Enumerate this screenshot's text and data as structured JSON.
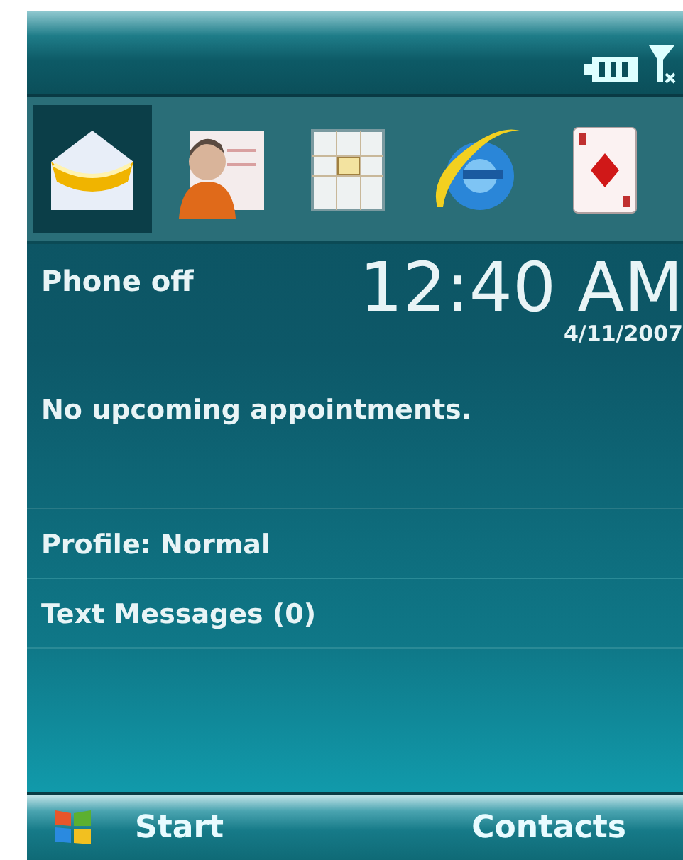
{
  "app_strip": [
    {
      "kind": "mail",
      "selected": true
    },
    {
      "kind": "contacts",
      "selected": false
    },
    {
      "kind": "calendar",
      "selected": false
    },
    {
      "kind": "browser",
      "selected": false
    },
    {
      "kind": "cards",
      "selected": false
    }
  ],
  "status": {
    "phone": "Phone off",
    "time": "12:40 AM",
    "date": "4/11/2007"
  },
  "appointments": "No upcoming appointments.",
  "items": [
    "Profile: Normal",
    "Text Messages (0)"
  ],
  "softkeys": {
    "left": "Start",
    "right": "Contacts"
  }
}
